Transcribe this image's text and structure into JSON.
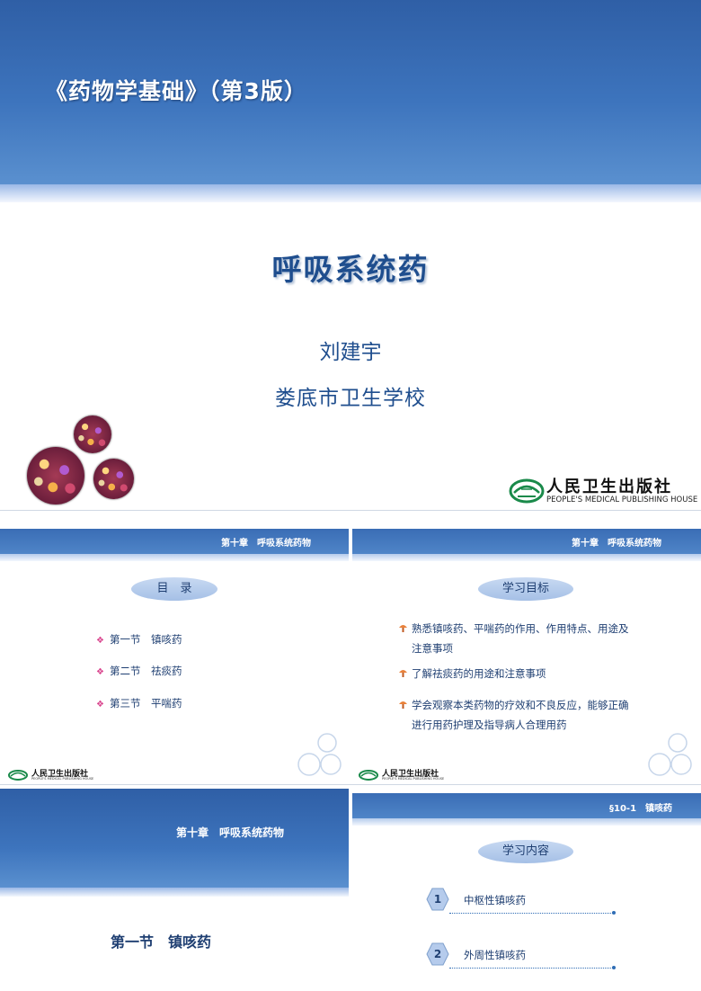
{
  "slide1": {
    "book_title": "《药物学基础》（第3版）",
    "topic": "呼吸系统药",
    "author": "刘建宇",
    "school": "娄底市卫生学校",
    "publisher_cn": "人民卫生出版社",
    "publisher_en": "PEOPLE'S MEDICAL PUBLISHING HOUSE"
  },
  "slide2": {
    "header": "第十章　呼吸系统药物",
    "pill": "目　录",
    "items": [
      "第一节　镇咳药",
      "第二节　祛痰药",
      "第三节　平喘药"
    ],
    "publisher_cn": "人民卫生出版社",
    "publisher_en": "PEOPLE'S MEDICAL PUBLISHING HOUSE"
  },
  "slide3": {
    "header": "第十章　呼吸系统药物",
    "pill": "学习目标",
    "goals": [
      {
        "line1": "熟悉镇咳药、平喘药的作用、作用特点、用途及",
        "line2": "注意事项"
      },
      {
        "line1": "了解祛痰药的用途和注意事项",
        "line2": ""
      },
      {
        "line1": "学会观察本类药物的疗效和不良反应，能够正确",
        "line2": "进行用药护理及指导病人合理用药"
      }
    ],
    "publisher_cn": "人民卫生出版社",
    "publisher_en": "PEOPLE'S MEDICAL PUBLISHING HOUSE"
  },
  "slide4": {
    "chapter": "第十章　呼吸系统药物",
    "section": "第一节　镇咳药"
  },
  "slide5": {
    "header": "§10-1　镇咳药",
    "pill": "学习内容",
    "items": [
      {
        "num": "1",
        "label": "中枢性镇咳药"
      },
      {
        "num": "2",
        "label": "外周性镇咳药"
      }
    ]
  },
  "colors": {
    "header_blue": "#3d74bd",
    "text_navy": "#1f3f72",
    "pill_blue": "#b5cbec",
    "bullet_pink": "#d9458e"
  }
}
